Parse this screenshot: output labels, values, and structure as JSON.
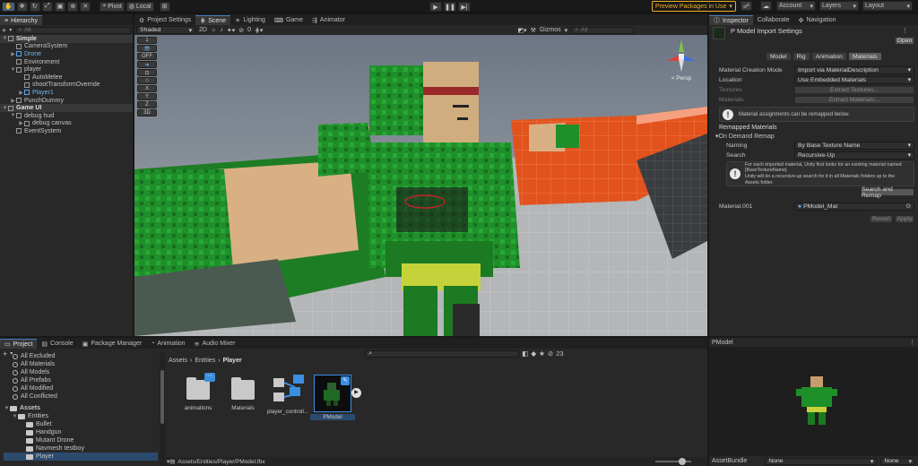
{
  "toolbar": {
    "pivot": "Pivot",
    "local": "Local",
    "preview_packages": "Preview Packages in Use",
    "account": "Account",
    "layers": "Layers",
    "layout": "Layout"
  },
  "hierarchy": {
    "tab": "Hierarchy",
    "search_placeholder": "All",
    "items": [
      {
        "label": "Simple",
        "indent": 0,
        "bold": true,
        "caret": "▼"
      },
      {
        "label": "CameraSystem",
        "indent": 1
      },
      {
        "label": "Drone",
        "indent": 1,
        "blue": true,
        "caret": "▶"
      },
      {
        "label": "Environment",
        "indent": 1
      },
      {
        "label": "player",
        "indent": 1,
        "caret": "▼"
      },
      {
        "label": "AutoMelee",
        "indent": 2
      },
      {
        "label": "shootTransformOverride",
        "indent": 2
      },
      {
        "label": "Player1",
        "indent": 2,
        "blue": true,
        "caret": "▶"
      },
      {
        "label": "PunchDummy",
        "indent": 1,
        "caret": "▶"
      },
      {
        "label": "Game UI",
        "indent": 0,
        "bold": true,
        "caret": "▼"
      },
      {
        "label": "debug hud",
        "indent": 1,
        "caret": "▼"
      },
      {
        "label": "debug canvas",
        "indent": 2,
        "caret": "▶"
      },
      {
        "label": "EventSystem",
        "indent": 1
      }
    ]
  },
  "scene": {
    "tabs": [
      "Project Settings",
      "Scene",
      "Lighting",
      "Game",
      "Animator"
    ],
    "shading": "Shaded",
    "mode_2d": "2D",
    "gizmos": "Gizmos",
    "search_placeholder": "All",
    "overlay_counter": "0",
    "persp": "< Persp",
    "side_tools": [
      "1",
      "OFF",
      "X",
      "Y",
      "Z",
      "3D"
    ]
  },
  "inspector": {
    "tabs": [
      "Inspector",
      "Collaborate",
      "Navigation"
    ],
    "title": "P Model Import Settings",
    "open": "Open",
    "subtabs": [
      "Model",
      "Rig",
      "Animation",
      "Materials"
    ],
    "rows": [
      {
        "label": "Material Creation Mode",
        "value": "Import via MaterialDescription"
      },
      {
        "label": "Location",
        "value": "Use Embedded Materials"
      }
    ],
    "textures_label": "Textures",
    "textures_btn": "Extract Textures...",
    "materials_label": "Materials",
    "materials_btn": "Extract Materials...",
    "remap_info": "Material assignments can be remapped below.",
    "remapped_header": "Remapped Materials",
    "on_demand": "On Demand Remap",
    "naming_label": "Naming",
    "naming_value": "By Base Texture Name",
    "search_label": "Search",
    "search_value": "Recursive-Up",
    "help_text_1": "For each imported material, Unity first looks for an existing material named",
    "help_text_2": "[BaseTextureName].",
    "help_text_3": "Unity will do a recursive-up search for it in all Materials folders up to the",
    "help_text_4": "Assets folder.",
    "search_remap_btn": "Search and Remap",
    "material_label": "Material.001",
    "material_value": "PModel_Mat",
    "revert": "Revert",
    "apply": "Apply"
  },
  "project": {
    "tabs": [
      "Project",
      "Console",
      "Package Manager",
      "Animation",
      "Audio Mixer"
    ],
    "favorites": [
      "All Excluded",
      "All Materials",
      "All Models",
      "All Prefabs",
      "All Modified",
      "All Conflicted"
    ],
    "assets_root": "Assets",
    "tree": [
      "Entities",
      "Bullet",
      "Handgun",
      "Mutant Drone",
      "Navmesh testboy",
      "Player"
    ],
    "breadcrumb": [
      "Assets",
      "Entities",
      "Player"
    ],
    "hidden_count": "23",
    "assets": [
      {
        "name": "animations",
        "type": "folder"
      },
      {
        "name": "Materials",
        "type": "folder"
      },
      {
        "name": "player_controll...",
        "type": "controller"
      },
      {
        "name": "PModel",
        "type": "model"
      }
    ],
    "path": "Assets/Entities/Player/PModel.fbx"
  },
  "preview": {
    "tab": "PModel",
    "assetbundle_label": "AssetBundle",
    "assetbundle_value": "None",
    "variant_value": "None"
  },
  "colors": {
    "accent": "#4a7bc4",
    "preview_badge": "#f0b020",
    "ground_orange": "#e2521c",
    "character_green": "#1f8f2a"
  }
}
